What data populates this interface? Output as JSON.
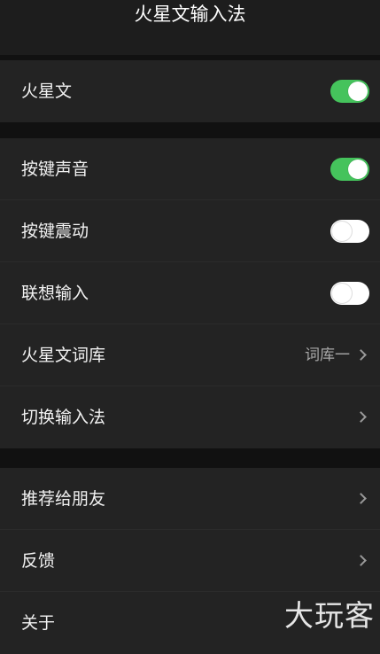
{
  "header": {
    "title": "火星文输入法"
  },
  "group1": {
    "items": [
      {
        "label": "火星文",
        "toggle": true
      }
    ]
  },
  "group2": {
    "items": [
      {
        "label": "按键声音",
        "toggle": true
      },
      {
        "label": "按键震动",
        "toggle": false
      },
      {
        "label": "联想输入",
        "toggle": false
      },
      {
        "label": "火星文词库",
        "value": "词库一"
      },
      {
        "label": "切换输入法"
      }
    ]
  },
  "group3": {
    "items": [
      {
        "label": "推荐给朋友"
      },
      {
        "label": "反馈"
      },
      {
        "label": "关于"
      }
    ]
  },
  "watermark": {
    "text": "大玩客"
  },
  "colors": {
    "background": "#111111",
    "panel": "#232323",
    "toggle_on": "#45c35c",
    "toggle_off": "#ffffff",
    "text": "#f2f2f2",
    "secondary_text": "#a9a9a9"
  },
  "icons": {
    "chevron": "chevron-right-icon"
  }
}
